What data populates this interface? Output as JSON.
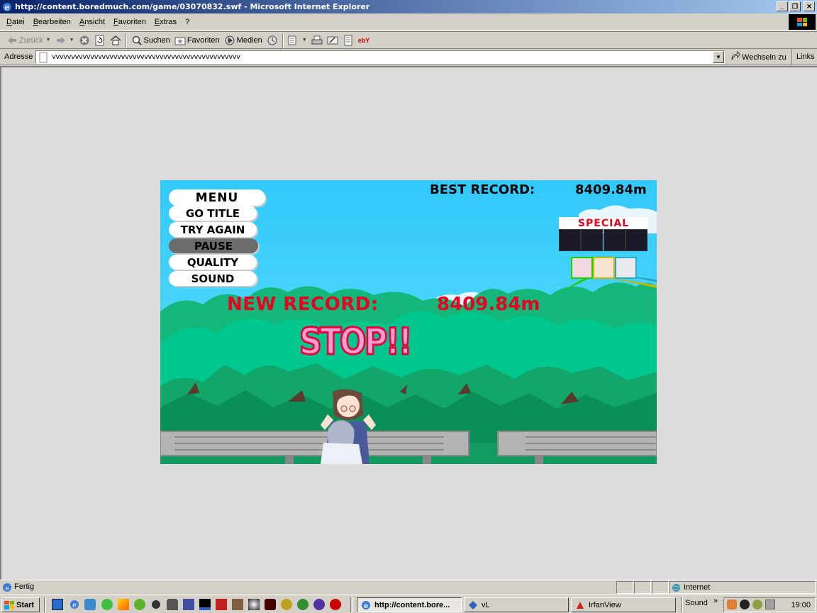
{
  "window": {
    "title": "http://content.boredmuch.com/game/03070832.swf - Microsoft Internet Explorer",
    "min_glyph": "_",
    "max_glyph": "❐",
    "close_glyph": "✕"
  },
  "menu": {
    "items": [
      "Datei",
      "Bearbeiten",
      "Ansicht",
      "Favoriten",
      "Extras",
      "?"
    ]
  },
  "toolbar": {
    "back_label": "Zurück",
    "search_label": "Suchen",
    "favorites_label": "Favoriten",
    "media_label": "Medien",
    "ebay_label": "ebY"
  },
  "address": {
    "label": "Adresse",
    "value": "vvvvvvvvvvvvvvvvvvvvvvvvvvvvvvvvvvvvvvvvvvvvvvvvv",
    "go_label": "Wechseln zu",
    "links_label": "Links"
  },
  "game": {
    "menu_title": "MENU",
    "buttons": [
      "GO TITLE",
      "TRY AGAIN",
      "PAUSE",
      "QUALITY",
      "SOUND"
    ],
    "best_record_label": "BEST RECORD:",
    "best_record_value": "8409.84m",
    "special_label": "SPECIAL",
    "new_record_label": "NEW RECORD:",
    "new_record_value": "8409.84m",
    "stop_text": "STOP!!",
    "colors": {
      "sky": "#31c9fb",
      "hill": "#00c78d",
      "forest": "#12a66b",
      "record_red": "#ea0020",
      "stop_pink": "#ff9cd0"
    }
  },
  "status": {
    "text": "Fertig",
    "zone": "Internet"
  },
  "taskbar": {
    "start_label": "Start",
    "tasks": [
      {
        "label": "http://content.bore...",
        "active": true
      },
      {
        "label": "vL",
        "active": false
      },
      {
        "label": "IrfanView",
        "active": false
      }
    ],
    "sound_label": "Sound",
    "chevron": "»",
    "clock": "19:00"
  }
}
